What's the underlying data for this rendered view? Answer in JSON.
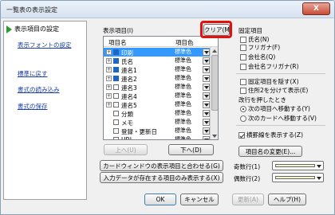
{
  "window": {
    "title": "一覧表の表示設定",
    "close_label": "X"
  },
  "nav": {
    "selected": "表示項目の設定",
    "links": [
      "表示フォントの設定",
      "標準に戻す",
      "書式の読み込み",
      "書式の保存"
    ]
  },
  "items_panel": {
    "label": "表示項目(I)",
    "clear_button": "クリア(M)",
    "col_name": "項目名",
    "col_color": "項目色",
    "rows": [
      {
        "name": "印刷",
        "color": "標準色",
        "checked": true,
        "expand": true,
        "selected": true
      },
      {
        "name": "氏名",
        "color": "標準色",
        "checked": true,
        "expand": true,
        "selected": false
      },
      {
        "name": "連名1",
        "color": "標準色",
        "checked": true,
        "expand": true,
        "selected": false
      },
      {
        "name": "連名2",
        "color": "標準色",
        "checked": true,
        "expand": true,
        "selected": false
      },
      {
        "name": "連名3",
        "color": "標準色",
        "checked": false,
        "expand": true,
        "selected": false
      },
      {
        "name": "連名4",
        "color": "標準色",
        "checked": false,
        "expand": true,
        "selected": false
      },
      {
        "name": "連名5",
        "color": "標準色",
        "checked": false,
        "expand": true,
        "selected": false
      },
      {
        "name": "分類",
        "color": "標準色",
        "checked": false,
        "expand": false,
        "selected": false
      },
      {
        "name": "メモ",
        "color": "標準色",
        "checked": false,
        "expand": false,
        "selected": false
      },
      {
        "name": "登録・更新日",
        "color": "標準色",
        "checked": false,
        "expand": false,
        "selected": false
      },
      {
        "name": "URL",
        "color": "標準色",
        "checked": false,
        "expand": false,
        "selected": false
      }
    ],
    "up_button": "上へ(U)",
    "down_button": "下へ(D)"
  },
  "fixed": {
    "label": "固定項目",
    "options": [
      {
        "label": "氏名(N)",
        "checked": false
      },
      {
        "label": "フリガナ(F)",
        "checked": false
      },
      {
        "label": "会社名(Q)",
        "checked": false
      },
      {
        "label": "会社名フリガナ(R)",
        "checked": false
      }
    ]
  },
  "display_opts": [
    {
      "label": "固定項目を隠す(X)",
      "checked": false
    },
    {
      "label": "住所2を分けて表示(E)",
      "checked": false
    }
  ],
  "move_label": "改行を押したとき",
  "move_opts": [
    {
      "label": "次の項目へ移動する(Y)",
      "checked": true
    },
    {
      "label": "次のカードへ移動する(V)",
      "checked": false
    }
  ],
  "horizontal_line": {
    "label": "横罫線を表示する(Z)",
    "checked": true
  },
  "rename_button": "項目名の変更(E)...",
  "card_window_button": "カードウィンドウの表示項目と合わせる(G)",
  "input_data_button": "入力データが存在する項目のみ表示する(X)",
  "odd_row_label": "奇数行(1)",
  "even_row_label": "偶数行(2)",
  "footer": {
    "ok": "OK",
    "cancel": "キャンセル",
    "apply": "更新(A)",
    "help": "ヘルプ(H)"
  }
}
